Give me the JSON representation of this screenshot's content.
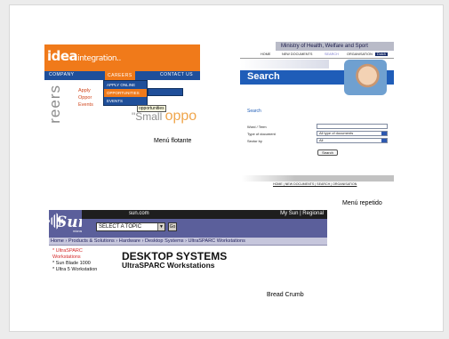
{
  "captions": {
    "floating": "Menú flotante",
    "repeated": "Menú repetido",
    "breadcrumb": "Bread Crumb"
  },
  "shot1": {
    "logo_main": "idea",
    "logo_sub": "integration",
    "logo_dots": "..",
    "nav": [
      "COMPANY",
      "CAREERS",
      "CONTACT US"
    ],
    "dropdown": [
      "APPLY ONLINE",
      "OPPORTUNITIES",
      "EVENTS"
    ],
    "submenu": "",
    "vertical_text": "reers",
    "links": [
      "Apply",
      "Oppor",
      "Events"
    ],
    "tooltip": "opportunities",
    "small": "\"Small",
    "big": "oppo",
    "colors": {
      "orange": "#f07a1a",
      "navy": "#1f4f9a"
    }
  },
  "shot2": {
    "ministry": "Ministry of Health, Welfare and Sport",
    "nav": [
      "HOME",
      "NEW DOCUMENTS",
      "SEARCH",
      "ORGANISATION"
    ],
    "nav_tag": "Dutch",
    "search_title": "Search",
    "search_small": "Search",
    "form": [
      {
        "label": "Word / Term",
        "value": ""
      },
      {
        "label": "Type of document",
        "value": "All type of documents"
      },
      {
        "label": "Sector by",
        "value": "All"
      }
    ],
    "button": "Search",
    "footer": "HOME | NEW DOCUMENTS | SEARCH | ORGANISATION",
    "colors": {
      "band": "#1f5db8"
    }
  },
  "shot3": {
    "site": "sun.com",
    "my_sun": "My Sun | Regional",
    "logo": "Sun.",
    "logo_sub": "microsystems",
    "select": "SELECT A TOPIC",
    "go": "Go",
    "crumb": "Home › Products & Solutions › Hardware › Desktop Systems › UltraSPARC Workstations",
    "left": [
      {
        "text": "* UltraSPARC",
        "style": "red"
      },
      {
        "text": "Workstations",
        "style": "red"
      },
      {
        "text": "* Sun Blade 1000",
        "style": "blk"
      },
      {
        "text": "* Ultra 5 Workstation",
        "style": "blk"
      }
    ],
    "title": "DESKTOP SYSTEMS",
    "subtitle": "UltraSPARC Workstations",
    "colors": {
      "bar": "#5b5f9b",
      "crumb": "#c6c6dc"
    }
  }
}
